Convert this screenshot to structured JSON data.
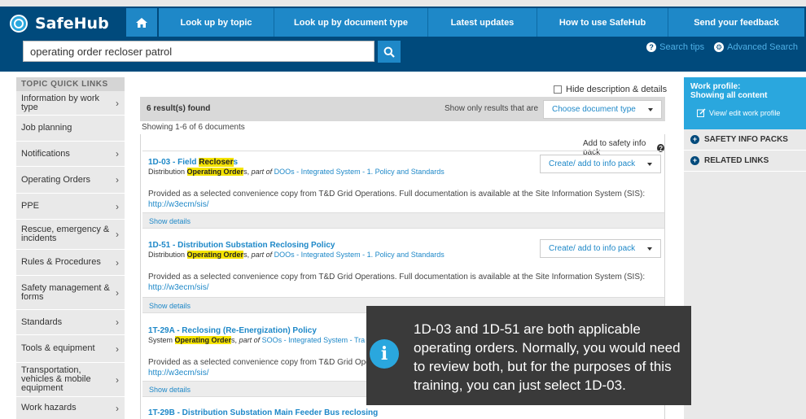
{
  "app": {
    "name": "SafeHub"
  },
  "nav": {
    "items": [
      {
        "label": "Look up by topic"
      },
      {
        "label": "Look up by document type"
      },
      {
        "label": "Latest updates"
      },
      {
        "label": "How to use SafeHub"
      },
      {
        "label": "Send your feedback"
      }
    ]
  },
  "search": {
    "value": "operating order recloser patrol",
    "tips": "Search tips",
    "advanced": "Advanced Search"
  },
  "sidebar": {
    "heading": "TOPIC QUICK LINKS",
    "items": [
      {
        "label": "Information by work type"
      },
      {
        "label": "Job planning"
      },
      {
        "label": "Notifications"
      },
      {
        "label": "Operating Orders"
      },
      {
        "label": "PPE"
      },
      {
        "label": "Rescue, emergency & incidents"
      },
      {
        "label": "Rules & Procedures"
      },
      {
        "label": "Safety management & forms"
      },
      {
        "label": "Standards"
      },
      {
        "label": "Tools & equipment"
      },
      {
        "label": "Transportation, vehicles & mobile equipment"
      },
      {
        "label": "Work hazards"
      }
    ]
  },
  "results": {
    "hide_desc_label": "Hide description & details",
    "count": "6 result(s) found",
    "filter_label": "Show only results that are",
    "filter_value": "Choose document type",
    "showing": "Showing 1-6 of 6 documents",
    "add_pack_label": "Add to safety info pack",
    "create_label": "Create/ add to info pack",
    "show_details": "Show details",
    "desc": "Provided as a selected convenience copy from T&D Grid Operations. Full documentation is available at the Site Information System (SIS):",
    "desc_short": "Provided as a selected convenience copy from T&D Grid Ope",
    "url": "http://w3ecm/sis/",
    "items": [
      {
        "title_pre": "1D-03 - Field ",
        "title_hl": "Recloser",
        "title_post": "s",
        "type": "Distribution",
        "hl": "Operating Order",
        "post": "s,",
        "part_of": "part of",
        "link": "DOOs - Integrated System - 1. Policy and Standards"
      },
      {
        "title": "1D-51 - Distribution Substation Reclosing Policy",
        "type": "Distribution",
        "hl": "Operating Order",
        "post": "s,",
        "part_of": "part of",
        "link": "DOOs - Integrated System - 1. Policy and Standards"
      },
      {
        "title": "1T-29A - Reclosing (Re-Energization) Policy",
        "type": "System",
        "hl": "Operating Order",
        "post": "s,",
        "part_of": "part of",
        "link": "SOOs - Integrated System - Tra"
      },
      {
        "title": "1T-29B - Distribution Substation Main Feeder Bus reclosing"
      }
    ]
  },
  "right_panel": {
    "work_profile": "Work profile:",
    "showing_all": "Showing all content",
    "edit": "View/ edit work profile",
    "packs": "SAFETY INFO PACKS",
    "related": "RELATED LINKS"
  },
  "tooltip": {
    "message": "1D-03 and 1D-51 are both applicable operating orders. Normally, you would need to review both, but for the purposes of this training, you can just select 1D-03."
  },
  "colors": {
    "header_bg": "#004a7c",
    "nav_bg": "#1e88c8",
    "accent": "#2aa7de",
    "highlight": "#f5e400",
    "tooltip_bg": "#3a3a3a"
  }
}
